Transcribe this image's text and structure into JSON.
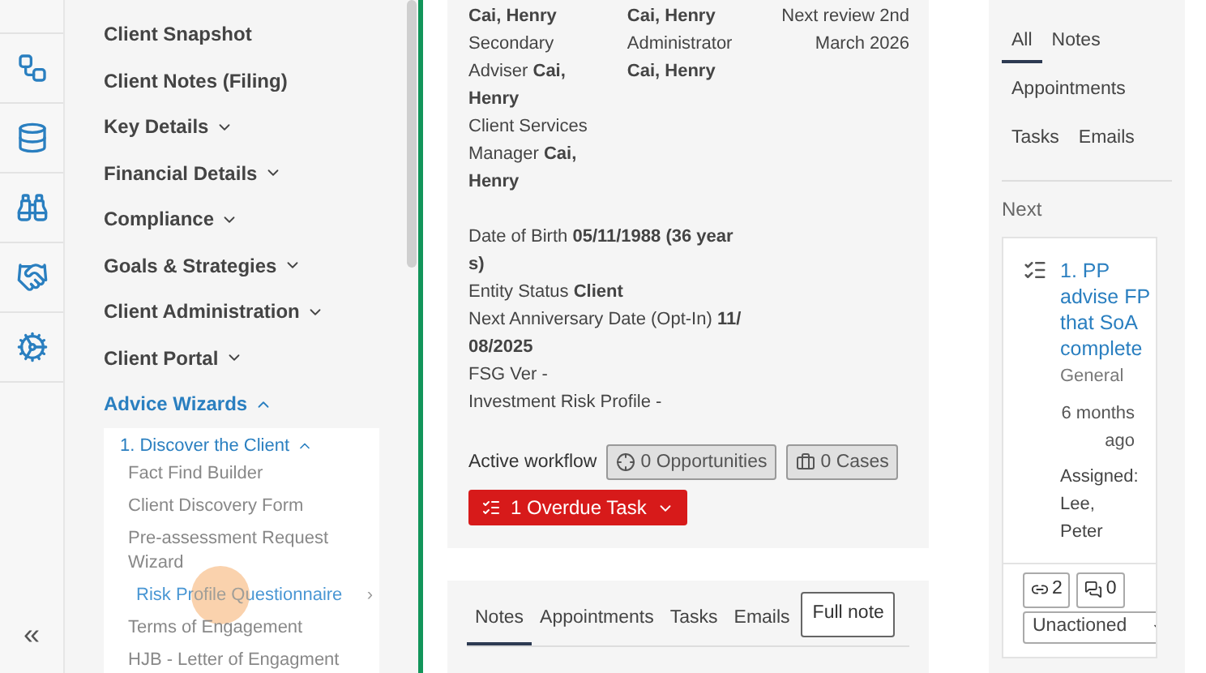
{
  "sidebar": {
    "items": [
      {
        "label": "Client Snapshot",
        "expandable": false,
        "expanded": false,
        "selected": false
      },
      {
        "label": "Client Notes (Filing)",
        "expandable": false,
        "expanded": false,
        "selected": false
      },
      {
        "label": "Key Details",
        "expandable": true,
        "expanded": false,
        "selected": false
      },
      {
        "label": "Financial Details",
        "expandable": true,
        "expanded": false,
        "selected": false
      },
      {
        "label": "Compliance",
        "expandable": true,
        "expanded": false,
        "selected": false
      },
      {
        "label": "Goals & Strategies",
        "expandable": true,
        "expanded": false,
        "selected": false
      },
      {
        "label": "Client Administration",
        "expandable": true,
        "expanded": false,
        "selected": false
      },
      {
        "label": "Client Portal",
        "expandable": true,
        "expanded": false,
        "selected": false
      },
      {
        "label": "Advice Wizards",
        "expanded": true,
        "selected": true,
        "children": [
          {
            "label": "1. Discover the Client",
            "expanded": true,
            "children": [
              {
                "label": "Fact Find Builder",
                "selected": false
              },
              {
                "label": "Client Discovery Form",
                "selected": false
              },
              {
                "label": "Pre-assessment Request Wizard",
                "selected": false
              },
              {
                "label": "Risk Profile Questionnaire",
                "selected": true,
                "submenu": "›"
              },
              {
                "label": "Terms of Engagement",
                "selected": false
              },
              {
                "label": "HJB - Letter of Engagment",
                "selected": false
              }
            ]
          }
        ]
      }
    ],
    "collapse": "«"
  },
  "summary": {
    "columns": [
      [
        "**Cai, Henry**",
        "Secondary Adviser **Cai, Henry**",
        "Client Services Manager **Cai, Henry**"
      ],
      [
        "**Cai, Henry**",
        "Administrator **Cai, Henry**"
      ],
      [
        "Next review 2nd March 2026"
      ]
    ],
    "details": [
      "Date of Birth **05/11/1988 (36 years)**",
      "Entity Status **Client**",
      "Next Anniversary Date (Opt-In) **11/08/2025**",
      "FSG Ver -",
      "Investment Risk Profile -"
    ],
    "workflow_label": "Active workflow",
    "opportunities": "0 Opportunities",
    "cases": "0 Cases",
    "overdue": "1 Overdue Task"
  },
  "notes": {
    "tabs": [
      {
        "label": "Notes",
        "selected": true
      },
      {
        "label": "Appointments",
        "selected": false
      },
      {
        "label": "Tasks",
        "selected": false
      },
      {
        "label": "Emails",
        "selected": false
      }
    ],
    "full_note": "Full note"
  },
  "activity": {
    "tabs": [
      {
        "label": "All",
        "selected": true
      },
      {
        "label": "Notes",
        "selected": false
      },
      {
        "label": "Appointments",
        "selected": false
      },
      {
        "label": "Tasks",
        "selected": false
      },
      {
        "label": "Emails",
        "selected": false
      }
    ],
    "next_label": "Next",
    "task": {
      "title": "1. PP advise FP that SoA complete",
      "category": "General",
      "time": "6 months ago",
      "assigned": "Assigned: Lee, Peter",
      "links": "2",
      "comments": "0",
      "status": "Unactioned"
    }
  }
}
